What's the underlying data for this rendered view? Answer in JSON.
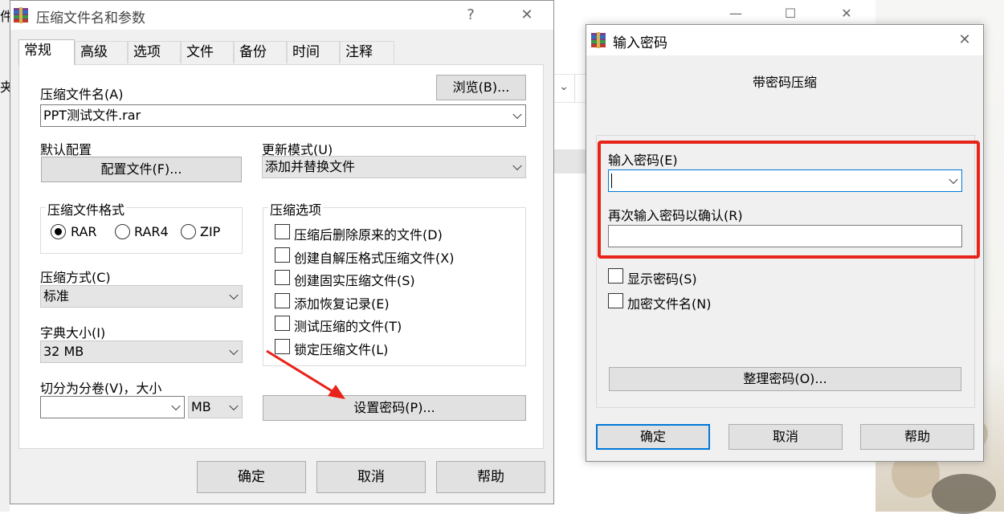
{
  "background": {
    "edge_text_top": "件",
    "edge_text_mid": "夹",
    "window_controls": [
      "—",
      "☐",
      "✕"
    ]
  },
  "archive_dialog": {
    "title": "压缩文件名和参数",
    "help_glyph": "?",
    "close_glyph": "✕",
    "tabs": [
      "常规",
      "高级",
      "选项",
      "文件",
      "备份",
      "时间",
      "注释"
    ],
    "active_tab": "常规",
    "archive_name_label": "压缩文件名(A)",
    "browse_button": "浏览(B)...",
    "archive_name_value": "PPT测试文件.rar",
    "default_profile_label": "默认配置",
    "profiles_button": "配置文件(F)...",
    "update_mode_label": "更新模式(U)",
    "update_mode_value": "添加并替换文件",
    "format_group_title": "压缩文件格式",
    "formats": [
      "RAR",
      "RAR4",
      "ZIP"
    ],
    "selected_format": "RAR",
    "options_group_title": "压缩选项",
    "options": [
      "压缩后删除原来的文件(D)",
      "创建自解压格式压缩文件(X)",
      "创建固实压缩文件(S)",
      "添加恢复记录(E)",
      "测试压缩的文件(T)",
      "锁定压缩文件(L)"
    ],
    "method_label": "压缩方式(C)",
    "method_value": "标准",
    "dict_label": "字典大小(I)",
    "dict_value": "32 MB",
    "split_label": "切分为分卷(V)，大小",
    "split_value": "",
    "split_unit": "MB",
    "set_password_button": "设置密码(P)...",
    "ok_button": "确定",
    "cancel_button": "取消",
    "help_button": "帮助"
  },
  "password_dialog": {
    "title": "输入密码",
    "close_glyph": "✕",
    "heading": "带密码压缩",
    "enter_password_label": "输入密码(E)",
    "enter_password_value": "",
    "confirm_password_label": "再次输入密码以确认(R)",
    "confirm_password_value": "",
    "show_password_label": "显示密码(S)",
    "encrypt_names_label": "加密文件名(N)",
    "organize_button": "整理密码(O)...",
    "ok_button": "确定",
    "cancel_button": "取消",
    "help_button": "帮助"
  },
  "colors": {
    "highlight_box": "#e8231a",
    "annotation_arrow": "#e8231a",
    "focus_border": "#0078d7"
  }
}
